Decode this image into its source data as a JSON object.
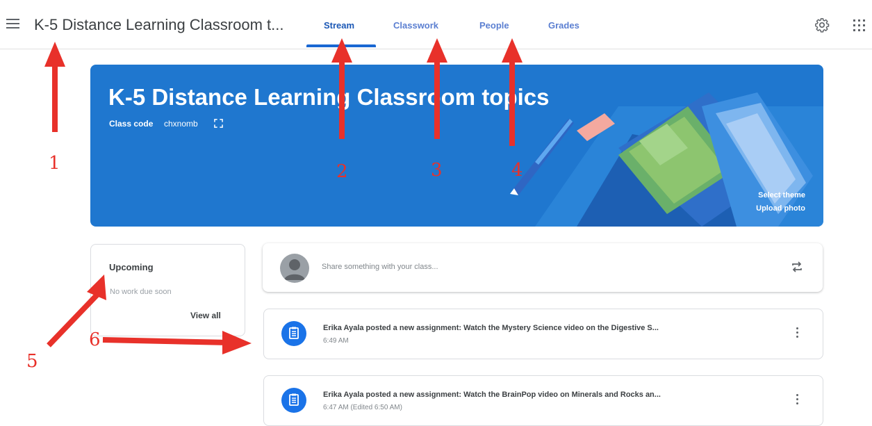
{
  "header": {
    "title": "K-5 Distance Learning Classroom t...",
    "tabs": [
      {
        "label": "Stream",
        "active": true
      },
      {
        "label": "Classwork",
        "active": false
      },
      {
        "label": "People",
        "active": false
      },
      {
        "label": "Grades",
        "active": false
      }
    ]
  },
  "banner": {
    "title": "K-5 Distance Learning Classroom topics",
    "class_code_label": "Class code",
    "class_code": "chxnomb",
    "select_theme": "Select theme",
    "upload_photo": "Upload photo"
  },
  "upcoming": {
    "title": "Upcoming",
    "empty_text": "No work due soon",
    "view_all": "View all"
  },
  "share": {
    "placeholder": "Share something with your class..."
  },
  "posts": [
    {
      "title": "Erika Ayala posted a new assignment: Watch the Mystery Science video on the Digestive S...",
      "time": "6:49 AM"
    },
    {
      "title": "Erika Ayala posted a new assignment: Watch the BrainPop video on Minerals and Rocks an...",
      "time": "6:47 AM (Edited 6:50 AM)"
    }
  ],
  "annotations": [
    "1",
    "2",
    "3",
    "4",
    "5",
    "6"
  ],
  "colors": {
    "accent": "#1967d2",
    "banner": "#1f77cf",
    "annotation": "#e8312a"
  }
}
